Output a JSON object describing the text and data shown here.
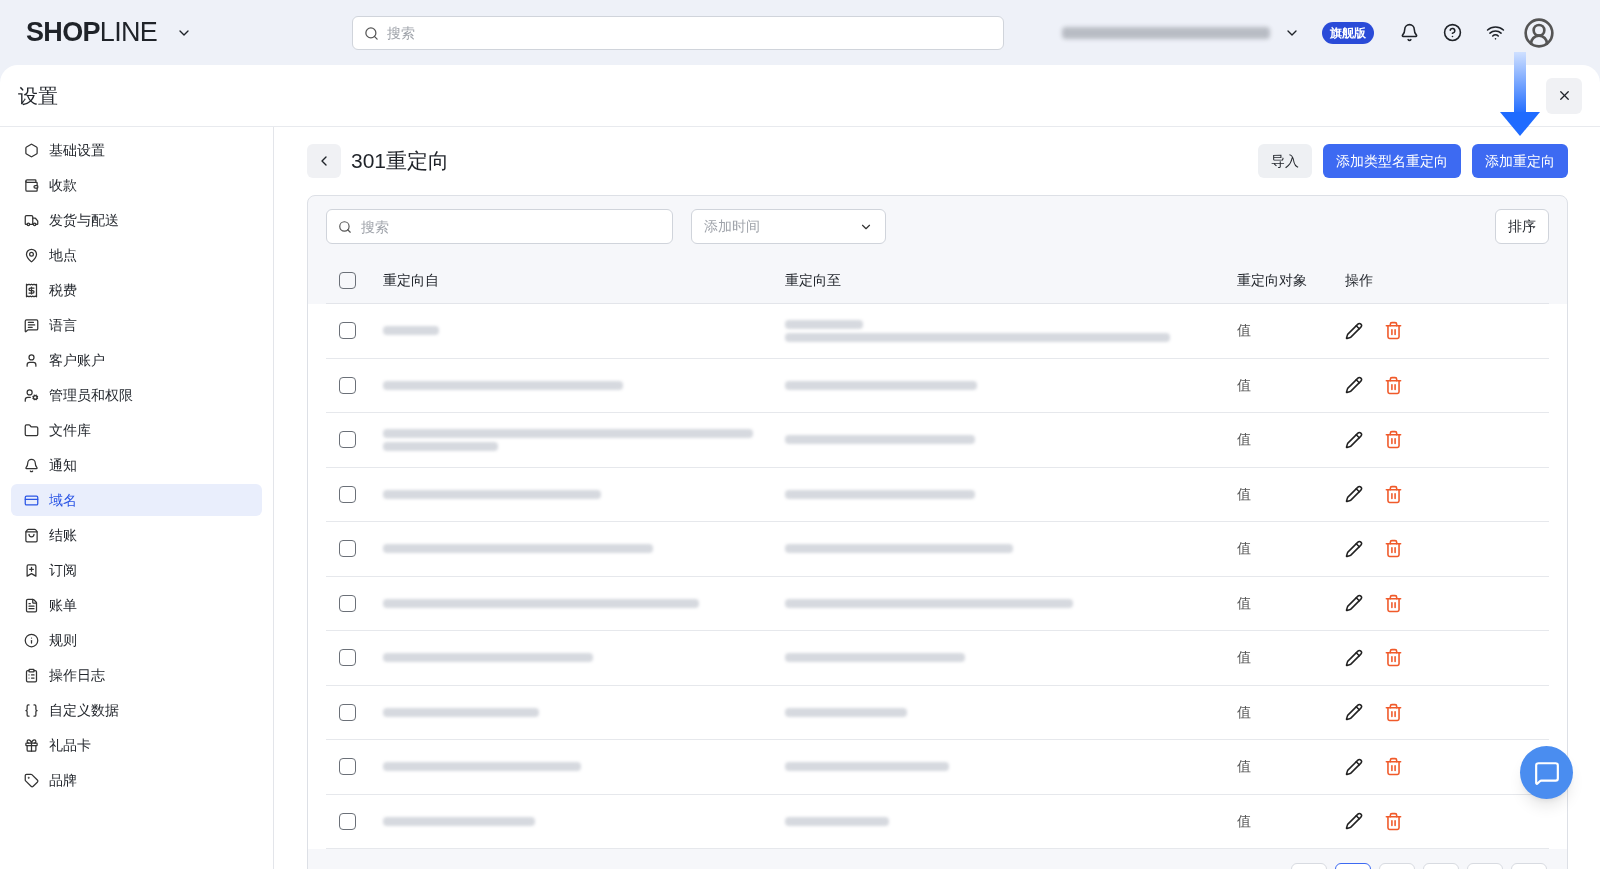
{
  "topbar": {
    "logo": "**SHOP**LINE",
    "search_placeholder": "搜索",
    "plan_badge": "旗舰版"
  },
  "panel": {
    "title": "设置"
  },
  "sidebar": {
    "items": [
      {
        "label": "基础设置",
        "selected": false
      },
      {
        "label": "收款",
        "selected": false
      },
      {
        "label": "发货与配送",
        "selected": false
      },
      {
        "label": "地点",
        "selected": false
      },
      {
        "label": "税费",
        "selected": false
      },
      {
        "label": "语言",
        "selected": false
      },
      {
        "label": "客户账户",
        "selected": false
      },
      {
        "label": "管理员和权限",
        "selected": false
      },
      {
        "label": "文件库",
        "selected": false
      },
      {
        "label": "通知",
        "selected": false
      },
      {
        "label": "域名",
        "selected": true
      },
      {
        "label": "结账",
        "selected": false
      },
      {
        "label": "订阅",
        "selected": false
      },
      {
        "label": "账单",
        "selected": false
      },
      {
        "label": "规则",
        "selected": false
      },
      {
        "label": "操作日志",
        "selected": false
      },
      {
        "label": "自定义数据",
        "selected": false
      },
      {
        "label": "礼品卡",
        "selected": false
      },
      {
        "label": "品牌",
        "selected": false
      }
    ]
  },
  "page": {
    "title": "301重定向",
    "buttons": [
      {
        "label": "导入",
        "kind": "secondary"
      },
      {
        "label": "添加类型名重定向",
        "kind": "primary"
      },
      {
        "label": "添加重定向",
        "kind": "primary"
      }
    ]
  },
  "filters": {
    "search_placeholder": "搜索",
    "date_placeholder": "添加时间",
    "sort": "排序"
  },
  "table": {
    "select_all_checked": false,
    "columns": [
      "重定向自",
      "重定向至",
      "重定向对象",
      "操作"
    ],
    "rows": [
      {
        "checked": false,
        "target": "值"
      },
      {
        "checked": false,
        "target": "值"
      },
      {
        "checked": false,
        "target": "值"
      },
      {
        "checked": false,
        "target": "值"
      },
      {
        "checked": false,
        "target": "值"
      },
      {
        "checked": false,
        "target": "值"
      },
      {
        "checked": false,
        "target": "值"
      },
      {
        "checked": false,
        "target": "值"
      },
      {
        "checked": false,
        "target": "值"
      },
      {
        "checked": false,
        "target": "值"
      }
    ]
  },
  "pagination": [
    {
      "selected": false
    },
    {
      "selected": true
    },
    {
      "selected": false
    },
    {
      "selected": false
    },
    {
      "selected": false
    },
    {
      "selected": false
    }
  ]
}
